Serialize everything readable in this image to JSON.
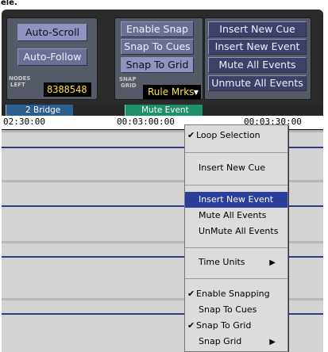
{
  "title_fragment": "ele.",
  "toolbar": {
    "auto_scroll": "Auto-Scroll",
    "auto_follow": "Auto-Follow",
    "nodes_label_1": "NODES",
    "nodes_label_2": "LEFT",
    "nodes_value": "8388548",
    "enable_snap": "Enable Snap",
    "snap_to_cues": "Snap To Cues",
    "snap_to_grid": "Snap To Grid",
    "snap_label_1": "SNAP",
    "snap_label_2": "GRID",
    "snap_grid_value": "Rule Mrks",
    "insert_new_cue": "Insert New Cue",
    "insert_new_event": "Insert New Event",
    "mute_all_events": "Mute All Events",
    "unmute_all_events": "Unmute All Events"
  },
  "tabs": {
    "bridge": "2 Bridge",
    "mute_event": "Mute Event"
  },
  "ruler": {
    "t1": "02:30:00",
    "t2": "00:03:00:00",
    "t3": "00:03:30:00"
  },
  "menu": {
    "loop_selection": "Loop Selection",
    "insert_new_cue": "Insert New Cue",
    "insert_new_event": "Insert New Event",
    "mute_all_events": "Mute All Events",
    "unmute_all_events": "UnMute All Events",
    "time_units": "Time Units",
    "enable_snapping": "Enable Snapping",
    "snap_to_cues": "Snap To Cues",
    "snap_to_grid": "Snap To Grid",
    "snap_grid": "Snap Grid"
  },
  "colors": {
    "panel": "#2b2b2b",
    "button": "#6a6f93",
    "highlight": "#2a3e9a",
    "readout_text": "#ffe23a",
    "track_line": "#2d3c8a",
    "mute_tab": "#1d8f6a"
  },
  "icons": [
    "checkmark-icon",
    "submenu-arrow-icon",
    "dropdown-triangle-icon"
  ]
}
